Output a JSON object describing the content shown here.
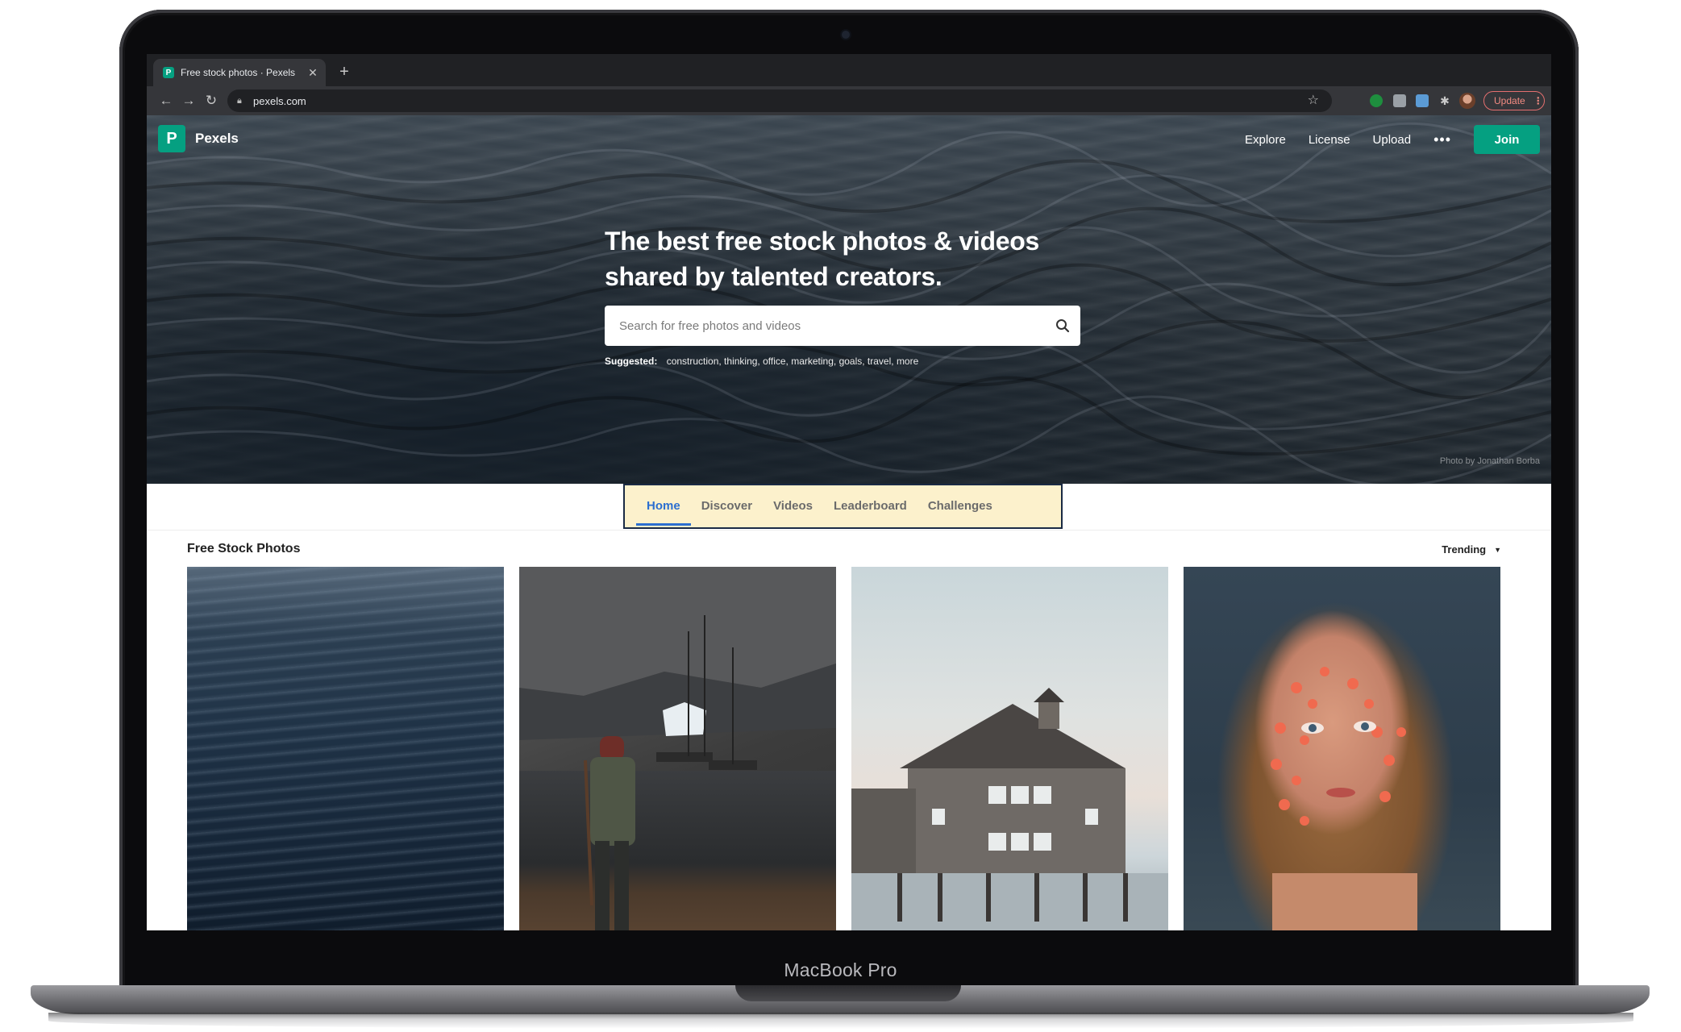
{
  "device": {
    "label": "MacBook Pro"
  },
  "browser": {
    "tab": {
      "title": "Free stock photos · Pexels",
      "favicon": "pexels-favicon"
    },
    "url": "pexels.com",
    "update_label": "Update"
  },
  "site": {
    "logo_text": "Pexels",
    "nav": [
      "Explore",
      "License",
      "Upload"
    ],
    "join_label": "Join",
    "brand_color": "#05a081"
  },
  "hero": {
    "title_line1": "The best free stock photos & videos",
    "title_line2": "shared by talented creators.",
    "search_placeholder": "Search for free photos and videos",
    "suggested_label": "Suggested:",
    "suggested": "construction, thinking, office, marketing, goals, travel, more",
    "photo_credit": "Photo by Jonathan Borba"
  },
  "page_tabs": {
    "items": [
      "Home",
      "Discover",
      "Videos",
      "Leaderboard",
      "Challenges"
    ],
    "active": "Home",
    "highlight_color": "#fcf1cc"
  },
  "gallery": {
    "title": "Free Stock Photos",
    "sort_label": "Trending",
    "photos": [
      "ocean-waves",
      "sailboat-hiker",
      "pier-house",
      "woman-heart-stickers"
    ]
  }
}
